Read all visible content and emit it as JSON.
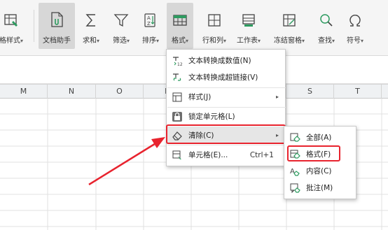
{
  "ribbon": {
    "tools": [
      {
        "name": "cell-style-tool",
        "icon": "table-style-icon",
        "label": "格样式",
        "caret": "▾"
      },
      {
        "name": "doc-assistant-tool",
        "icon": "doc-assistant-icon",
        "label": "文档助手",
        "caret": ""
      },
      {
        "name": "sum-tool",
        "icon": "sigma-icon",
        "label": "求和",
        "caret": "▾"
      },
      {
        "name": "filter-tool",
        "icon": "filter-icon",
        "label": "筛选",
        "caret": "▾"
      },
      {
        "name": "sort-tool",
        "icon": "sort-icon",
        "label": "排序",
        "caret": "▾"
      },
      {
        "name": "format-tool",
        "icon": "format-icon",
        "label": "格式",
        "caret": "▾"
      },
      {
        "name": "rows-cols-tool",
        "icon": "rows-cols-icon",
        "label": "行和列",
        "caret": "▾"
      },
      {
        "name": "worksheet-tool",
        "icon": "worksheet-icon",
        "label": "工作表",
        "caret": "▾"
      },
      {
        "name": "freeze-panes-tool",
        "icon": "freeze-panes-icon",
        "label": "冻结窗格",
        "caret": "▾"
      },
      {
        "name": "find-tool",
        "icon": "search-icon",
        "label": "查找",
        "caret": "▾"
      },
      {
        "name": "symbol-tool",
        "icon": "omega-icon",
        "label": "符号",
        "caret": "▾"
      }
    ]
  },
  "columns": [
    "M",
    "N",
    "O",
    "P",
    "Q",
    "R",
    "S",
    "T"
  ],
  "format_menu": {
    "items": [
      {
        "name": "text-to-number-item",
        "icon": "text-to-number-icon",
        "label": "文本转换成数值(N)"
      },
      {
        "name": "text-to-hyperlink-item",
        "icon": "text-to-link-icon",
        "label": "文本转换成超链接(V)"
      },
      {
        "name": "style-item",
        "icon": "style-icon",
        "label": "样式(J)",
        "arrow": "▸"
      },
      {
        "name": "lock-cell-item",
        "icon": "lock-cell-icon",
        "label": "锁定单元格(L)"
      },
      {
        "name": "clear-item",
        "icon": "eraser-icon",
        "label": "清除(C)",
        "arrow": "▸"
      },
      {
        "name": "cell-format-item",
        "icon": "cell-format-icon",
        "label": "单元格(E)...",
        "shortcut": "Ctrl+1"
      }
    ]
  },
  "clear_submenu": {
    "items": [
      {
        "name": "clear-all-item",
        "icon": "clear-all-icon",
        "label": "全部(A)"
      },
      {
        "name": "clear-formats-item",
        "icon": "clear-formats-icon",
        "label": "格式(F)"
      },
      {
        "name": "clear-contents-item",
        "icon": "clear-contents-icon",
        "label": "内容(C)"
      },
      {
        "name": "clear-comments-item",
        "icon": "clear-comments-icon",
        "label": "批注(M)"
      }
    ]
  },
  "colors": {
    "accent": "#e8232e",
    "icon_green": "#2c9b5f",
    "icon_gray": "#555555",
    "hover_bg": "#e6e6e6"
  }
}
